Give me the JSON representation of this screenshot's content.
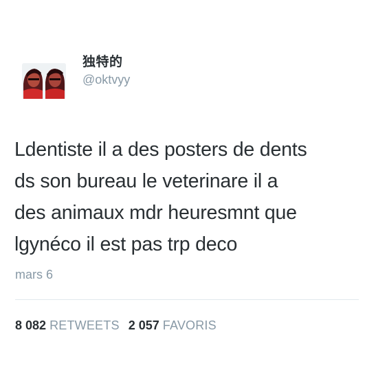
{
  "user": {
    "display_name": "独特的",
    "handle": "@oktvyy",
    "avatar_icon": "profile-photo"
  },
  "tweet": {
    "lines": [
      "Ldentiste il a des posters de dents",
      "ds son bureau le veterinare il a",
      "des animaux mdr heuresmnt que",
      "lgynéco il est pas trp deco"
    ],
    "timestamp": "mars 6"
  },
  "stats": {
    "retweets_count": "8 082",
    "retweets_label": "RETWEETS",
    "favorites_count": "2 057",
    "favorites_label": "FAVORIS"
  },
  "colors": {
    "text": "#292f33",
    "muted": "#8899a6",
    "divider": "#e1e8ed"
  }
}
